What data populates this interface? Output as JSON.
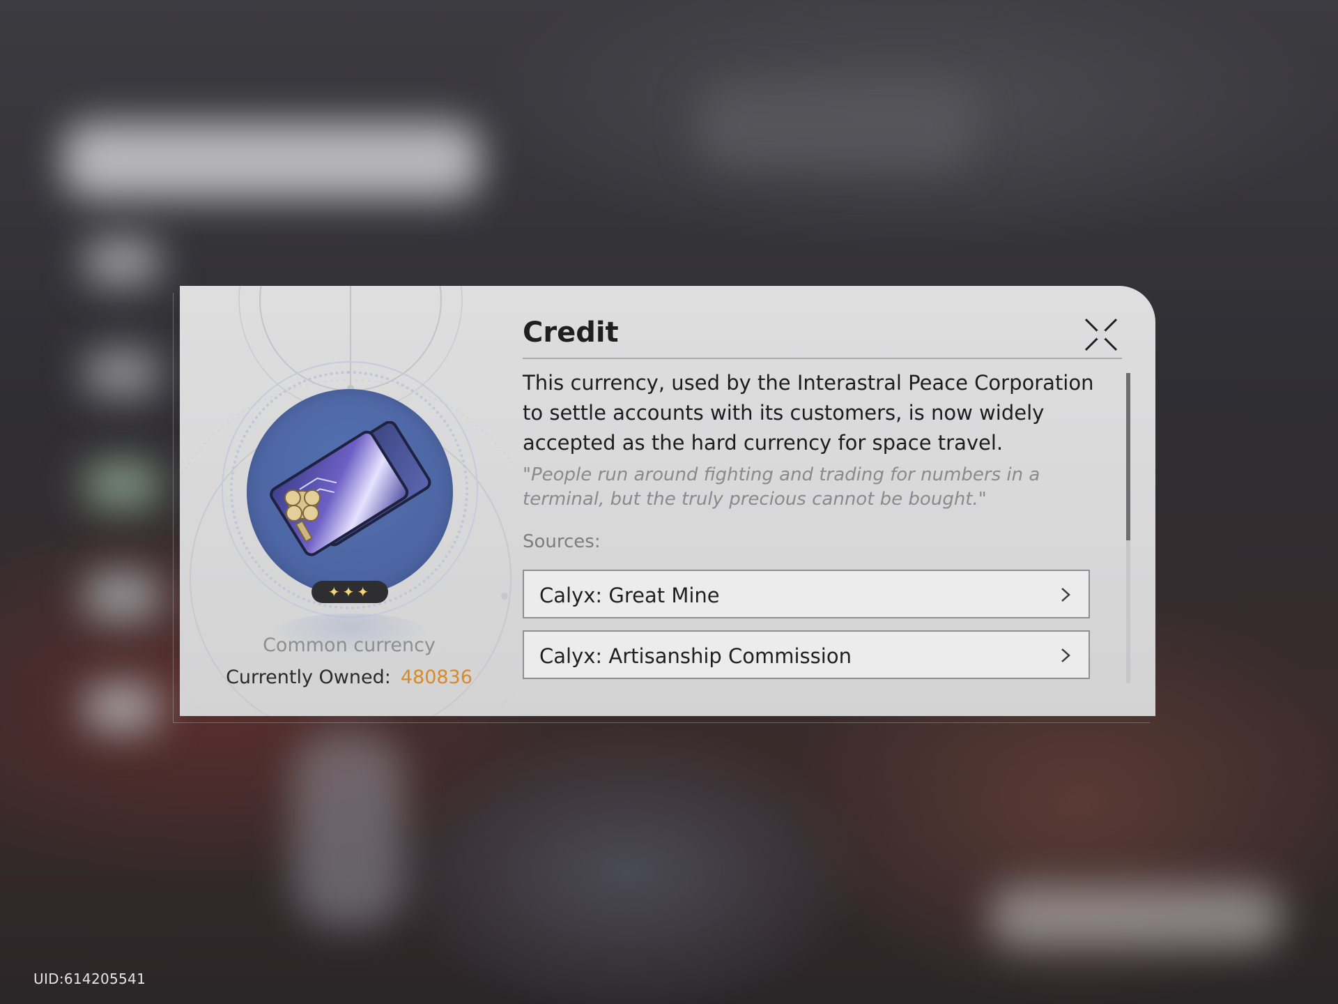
{
  "item": {
    "name": "Credit",
    "rarity_stars": "✦✦✦",
    "category": "Common currency",
    "owned_label": "Currently Owned:",
    "owned_value": "480836",
    "description": "This currency, used by the Interastral Peace Corporation to settle accounts with its customers, is now widely accepted as the hard currency for space travel.",
    "flavor_text": "\"People run around fighting and trading for numbers in a terminal, but the truly precious cannot be bought.\"",
    "sources_label": "Sources:",
    "sources": [
      {
        "label": "Calyx: Great Mine"
      },
      {
        "label": "Calyx: Artisanship Commission"
      }
    ]
  },
  "footer": {
    "uid": "UID:614205541"
  },
  "colors": {
    "owned_value": "#d78a2b",
    "orb": "#4d66a4",
    "star": "#f3d57a"
  },
  "icons": [
    "close-icon",
    "credit-card-icon",
    "chevron-right-icon"
  ]
}
